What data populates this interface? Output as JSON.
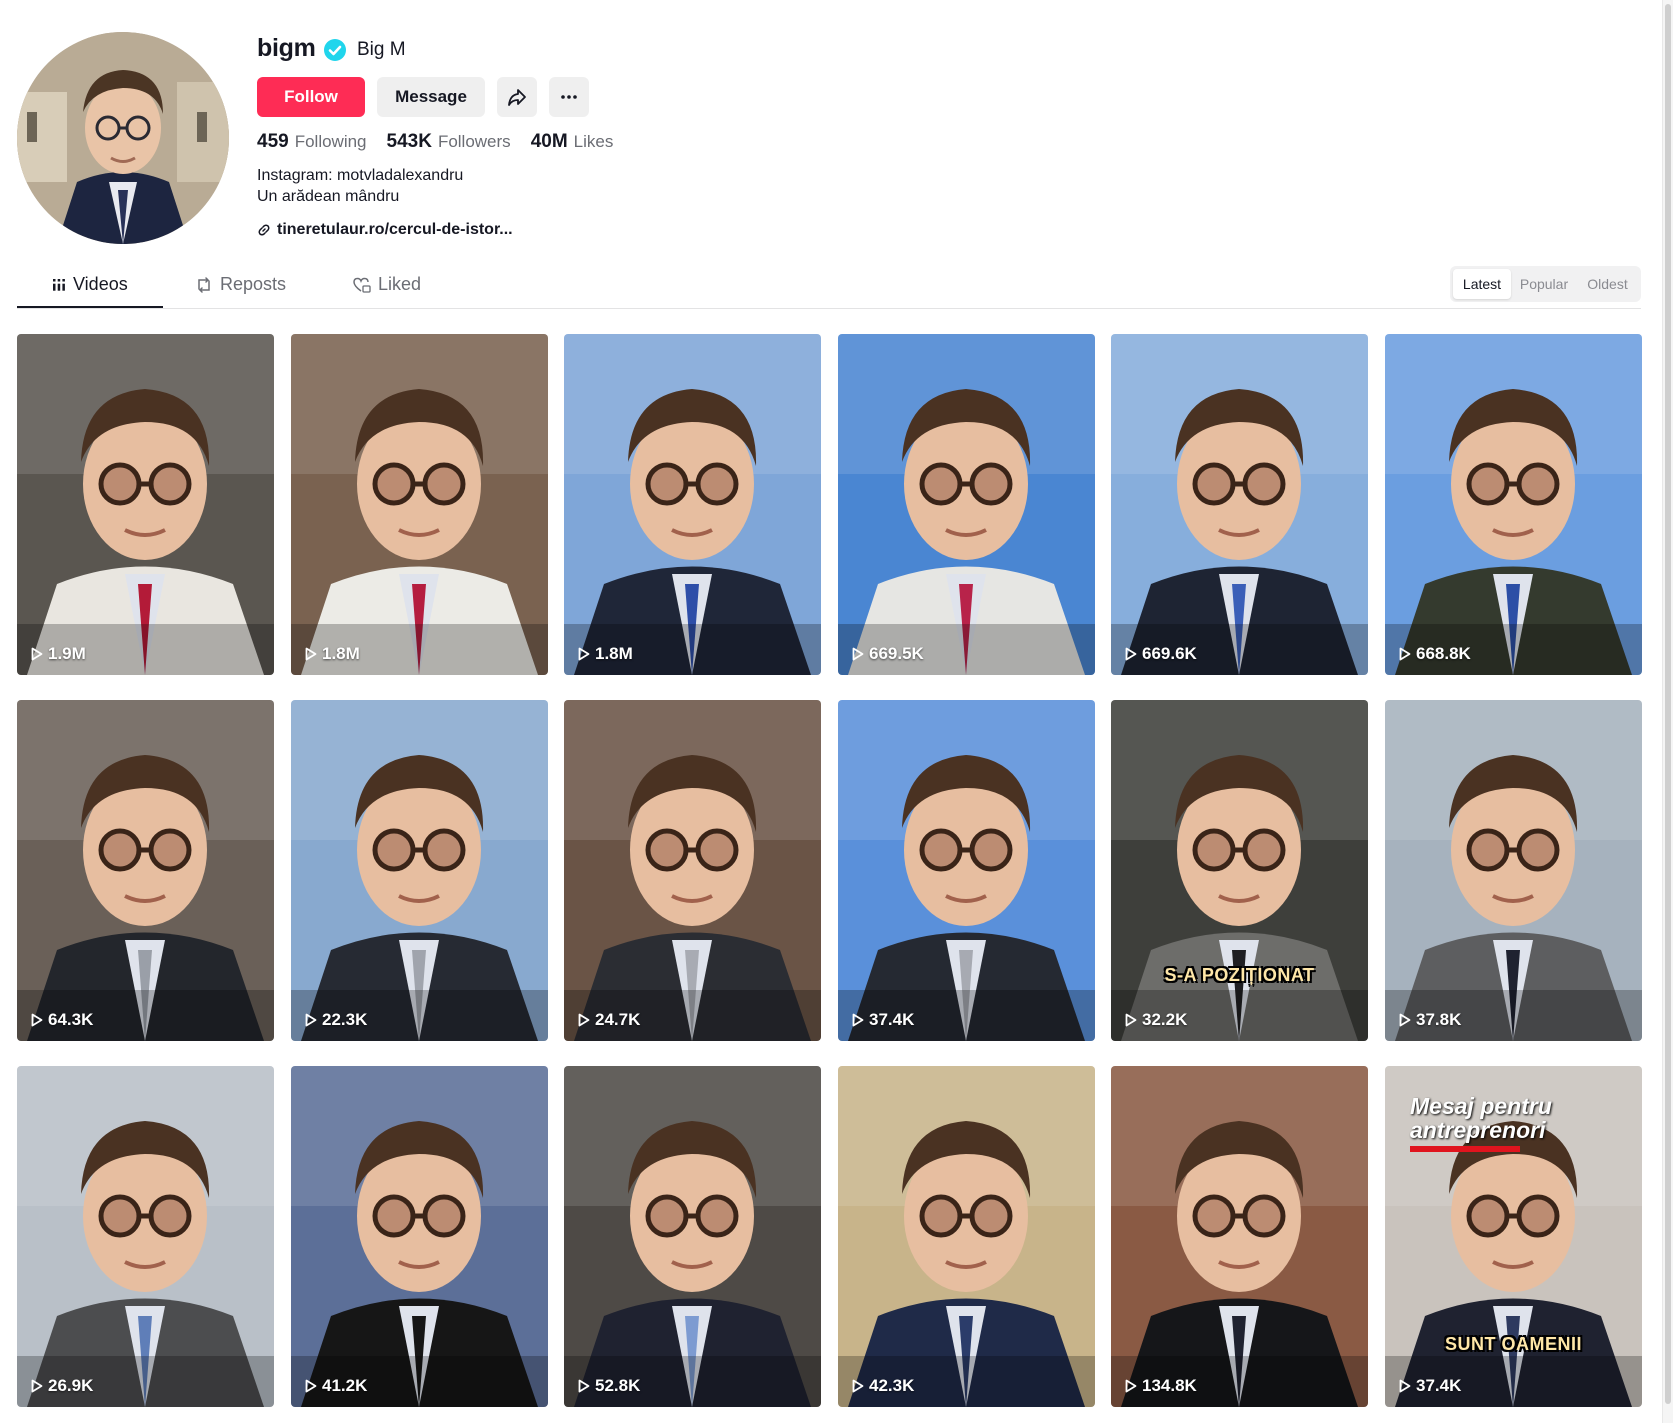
{
  "profile": {
    "username": "bigm",
    "nickname": "Big M",
    "follow_label": "Follow",
    "message_label": "Message",
    "stats": [
      {
        "value": "459",
        "label": "Following"
      },
      {
        "value": "543K",
        "label": "Followers"
      },
      {
        "value": "40M",
        "label": "Likes"
      }
    ],
    "bio_line1": "Instagram: motvladalexandru",
    "bio_line2": "Un arădean mândru",
    "link": "tineretulaur.ro/cercul-de-istor..."
  },
  "tabs": [
    {
      "label": "Videos",
      "icon": "grid-icon"
    },
    {
      "label": "Reposts",
      "icon": "repost-icon"
    },
    {
      "label": "Liked",
      "icon": "heart-lock-icon"
    }
  ],
  "sort": [
    "Latest",
    "Popular",
    "Oldest"
  ],
  "videos": [
    {
      "views": "1.9M",
      "bg": "#5a5650",
      "clothes": "#e9e6e0",
      "tie": "#b31b38"
    },
    {
      "views": "1.8M",
      "bg": "#7a6250",
      "clothes": "#ecebe6",
      "tie": "#b51d40"
    },
    {
      "views": "1.8M",
      "bg": "#7fa6d8",
      "clothes": "#1f2638",
      "tie": "#2e4ea8"
    },
    {
      "views": "669.5K",
      "bg": "#4a86d2",
      "clothes": "#e6e6e3",
      "tie": "#b8234a"
    },
    {
      "views": "669.6K",
      "bg": "#87aedc",
      "clothes": "#1e2433",
      "tie": "#3b5fb8"
    },
    {
      "views": "668.8K",
      "bg": "#6b9ee0",
      "clothes": "#343a2e",
      "tie": "#2c4fa6"
    },
    {
      "views": "64.3K",
      "bg": "#6a6058",
      "clothes": "#23262c",
      "tie": "#9a9fa8"
    },
    {
      "views": "22.3K",
      "bg": "#88a9cf",
      "clothes": "#262a33",
      "tie": "#a0a4ad"
    },
    {
      "views": "24.7K",
      "bg": "#6a5446",
      "clothes": "#2b2d33",
      "tie": "#a8abb3"
    },
    {
      "views": "37.4K",
      "bg": "#5a90da",
      "clothes": "#252932",
      "tie": "#a7aab2"
    },
    {
      "views": "32.2K",
      "bg": "#3e3f3b",
      "clothes": "#6d6d6a",
      "tie": "#1f1f22",
      "caption": "S-A POZIȚIONAT"
    },
    {
      "views": "37.8K",
      "bg": "#a6b2be",
      "clothes": "#5d5e60",
      "tie": "#1f2230"
    },
    {
      "views": "26.9K",
      "bg": "#b9c0c8",
      "clothes": "#4c4d4f",
      "tie": "#5f7eb8"
    },
    {
      "views": "41.2K",
      "bg": "#5c6f98",
      "clothes": "#161616",
      "tie": "#161616"
    },
    {
      "views": "52.8K",
      "bg": "#4e4a46",
      "clothes": "#1f2230",
      "tie": "#7d9bd1"
    },
    {
      "views": "42.3K",
      "bg": "#c8b48a",
      "clothes": "#1f2a48",
      "tie": "#2b3c6a"
    },
    {
      "views": "134.8K",
      "bg": "#8a5a44",
      "clothes": "#151619",
      "tie": "#1f2230"
    },
    {
      "views": "37.4K",
      "bg": "#c9c3bd",
      "clothes": "#1f2230",
      "tie": "#2e3a60",
      "caption": "SUNT OAMENII",
      "title1": "Mesaj pentru",
      "title2": "antreprenori"
    }
  ]
}
